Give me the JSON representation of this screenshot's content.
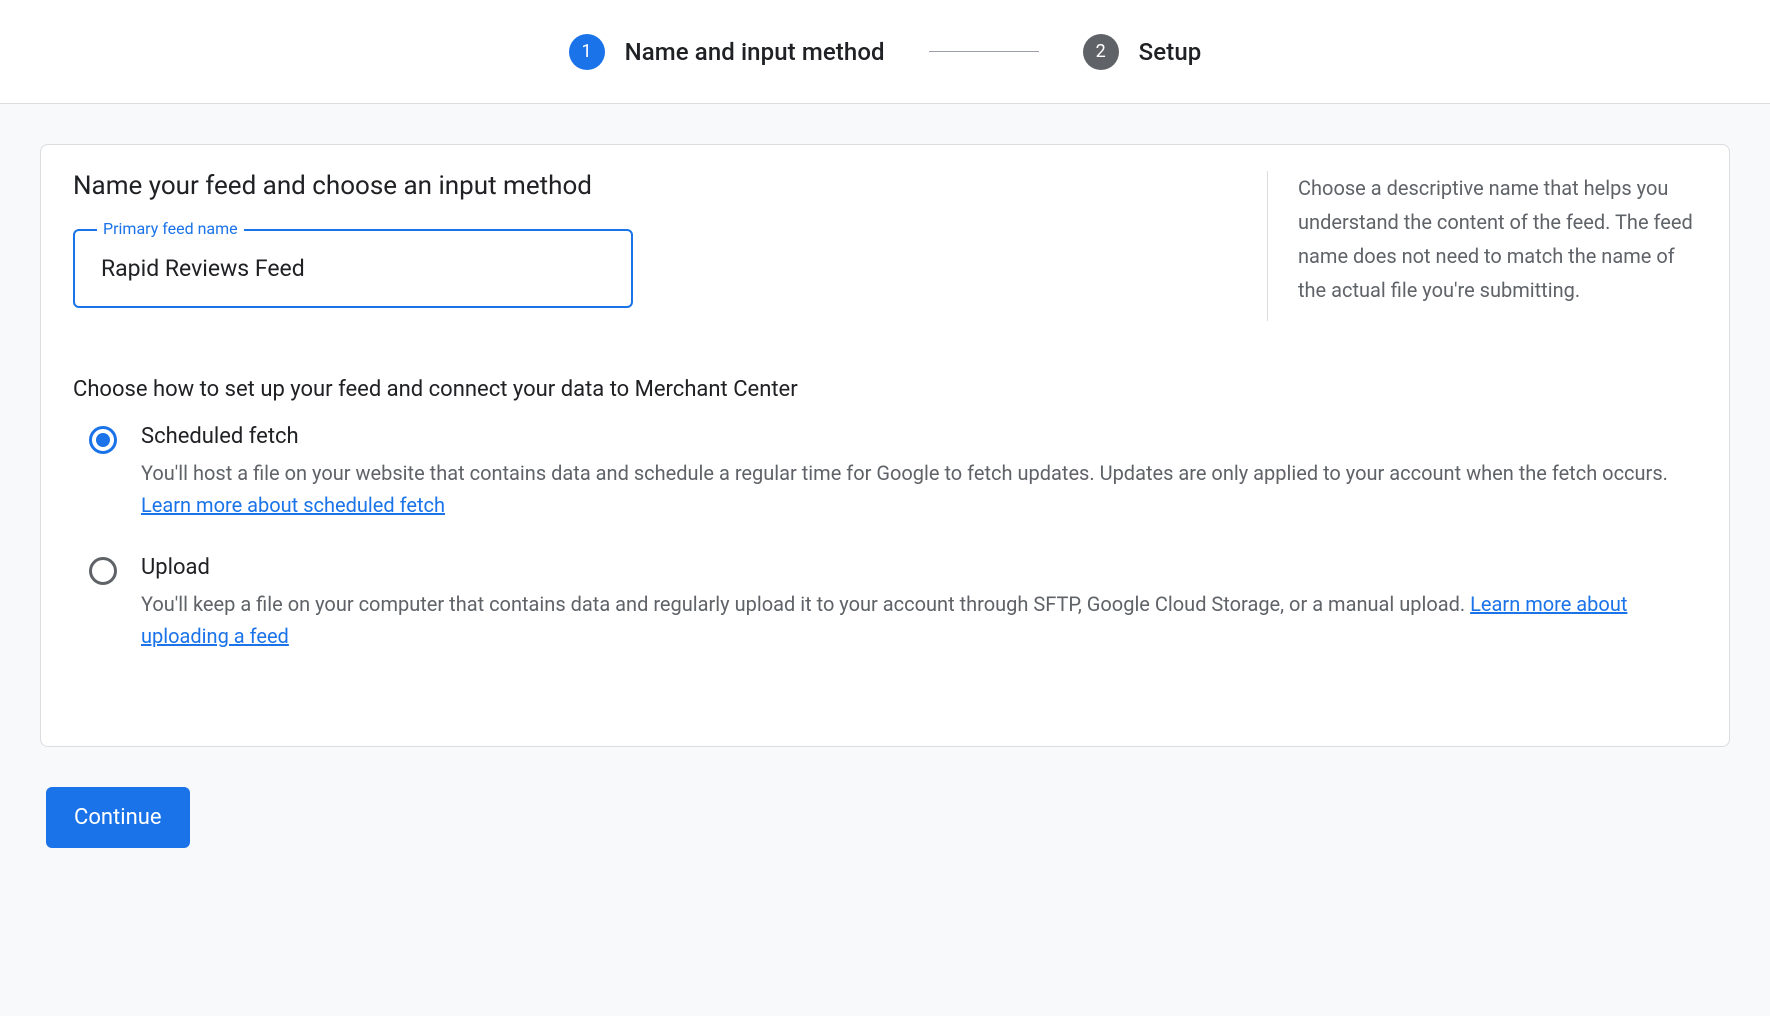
{
  "stepper": {
    "steps": [
      {
        "num": "1",
        "label": "Name and input method",
        "active": true
      },
      {
        "num": "2",
        "label": "Setup",
        "active": false
      }
    ]
  },
  "card": {
    "heading": "Name your feed and choose an input method",
    "feed_name_label": "Primary feed name",
    "feed_name_value": "Rapid Reviews Feed",
    "help_text": "Choose a descriptive name that helps you understand the content of the feed. The feed name does not need to match the name of the actual file you're submitting.",
    "choose_heading": "Choose how to set up your feed and connect your data to Merchant Center",
    "options": [
      {
        "title": "Scheduled fetch",
        "desc": "You'll host a file on your website that contains data and schedule a regular time for Google to fetch updates. Updates are only applied to your account when the fetch occurs. ",
        "link": "Learn more about scheduled fetch",
        "selected": true
      },
      {
        "title": "Upload",
        "desc": "You'll keep a file on your computer that contains data and regularly upload it to your account through SFTP, Google Cloud Storage, or a manual upload. ",
        "link": "Learn more about uploading a feed",
        "selected": false
      }
    ]
  },
  "continue_label": "Continue"
}
